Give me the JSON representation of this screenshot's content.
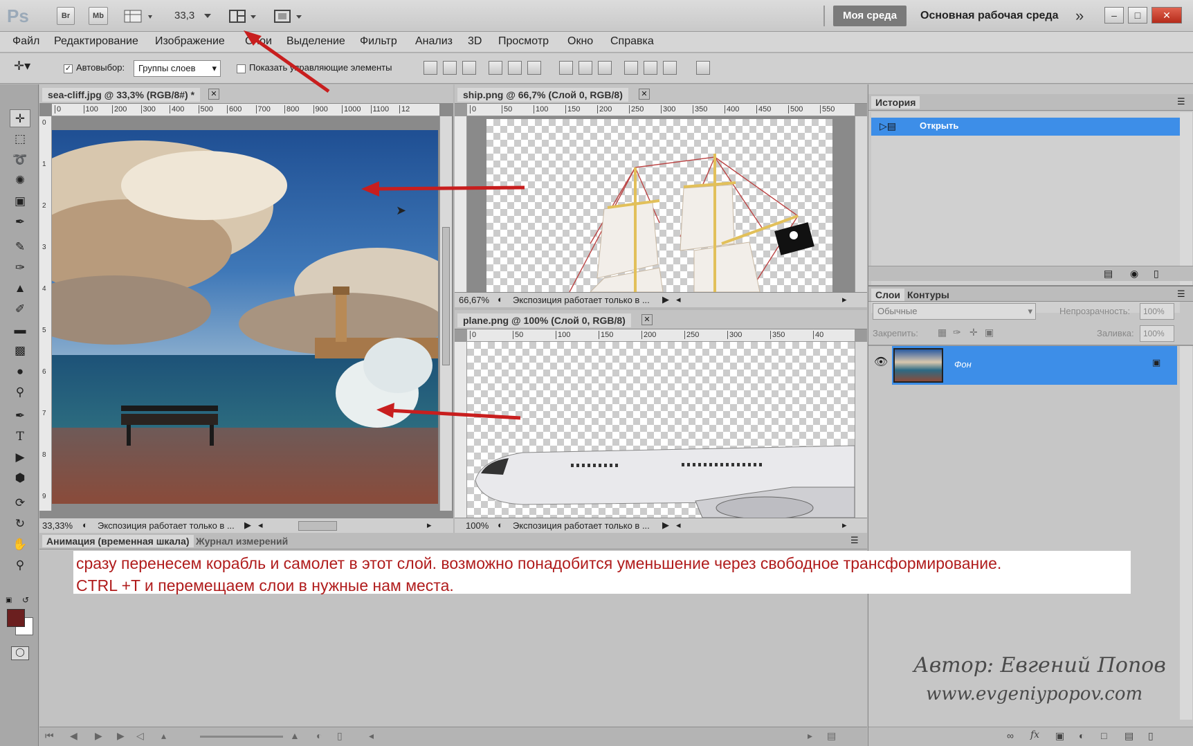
{
  "app": {
    "logo": "Ps",
    "bridge_btn": "Br",
    "minibridge_btn": "Mb",
    "zoom_value": "33,3",
    "workspace_btn": "Моя среда",
    "workspace_name": "Основная рабочая среда",
    "more_glyph": "»"
  },
  "menu": [
    "Файл",
    "Редактирование",
    "Изображение",
    "Слои",
    "Выделение",
    "Фильтр",
    "Анализ",
    "3D",
    "Просмотр",
    "Окно",
    "Справка"
  ],
  "options": {
    "autoselect_label": "Автовыбор:",
    "autoselect_value": "Группы слоев",
    "show_transform_label": "Показать управляющие элементы"
  },
  "docs": {
    "sea": {
      "title": "sea-cliff.jpg @ 33,3% (RGB/8#) *",
      "zoom": "33,33%",
      "status": "Экспозиция работает только в ...",
      "ruler": [
        "0",
        "100",
        "200",
        "300",
        "400",
        "500",
        "600",
        "700",
        "800",
        "900",
        "1000",
        "1100",
        "12"
      ],
      "vruler": [
        "0",
        "1",
        "2",
        "3",
        "4",
        "5",
        "6",
        "7",
        "8",
        "9"
      ]
    },
    "ship": {
      "title": "ship.png @ 66,7% (Слой 0, RGB/8)",
      "zoom": "66,67%",
      "status": "Экспозиция работает только в ...",
      "ruler": [
        "0",
        "50",
        "100",
        "150",
        "200",
        "250",
        "300",
        "350",
        "400",
        "450",
        "500",
        "550"
      ]
    },
    "plane": {
      "title": "plane.png @ 100% (Слой 0, RGB/8)",
      "zoom": "100%",
      "status": "Экспозиция работает только в ...",
      "ruler": [
        "0",
        "50",
        "100",
        "150",
        "200",
        "250",
        "300",
        "350",
        "40"
      ]
    }
  },
  "history": {
    "tab": "История",
    "item": "Открыть"
  },
  "layers": {
    "tab_layers": "Слои",
    "tab_paths": "Контуры",
    "blend_mode": "Обычные",
    "opacity_label": "Непрозрачность:",
    "opacity_value": "100%",
    "lock_label": "Закрепить:",
    "fill_label": "Заливка:",
    "fill_value": "100%",
    "layer_name": "Фон"
  },
  "bottom": {
    "tab_animation": "Анимация (временная шкала)",
    "tab_measure": "Журнал измерений",
    "subtitle_line1": "сразу перенесем корабль и самолет в этот слой. возможно понадобится уменьшение через свободное трансформирование.",
    "subtitle_line2": "CTRL +T и перемещаем слои в нужные нам места.",
    "author_line": "Автор: Евгений Попов",
    "site_line": "www.evgeniypopov.com"
  },
  "colors": {
    "foreground": "#6b1f1f",
    "background": "#ffffff",
    "selection": "#3d8ee8",
    "arrow": "#c81e1e"
  }
}
